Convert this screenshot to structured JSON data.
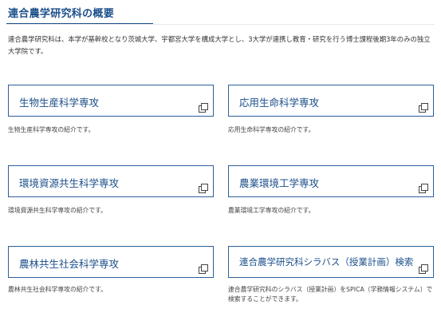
{
  "section": {
    "title": "連合農学研究科の概要",
    "intro": "連合農学研究科は、本学が基幹校となり茨城大学、宇都宮大学を構成大学とし、3大学が連携し教育・研究を行う博士課程後期3年のみの独立大学院です。"
  },
  "cards": [
    {
      "title": "生物生産科学専攻",
      "desc": "生物生産科学専攻の紹介です。",
      "icon": "external-window-icon"
    },
    {
      "title": "応用生命科学専攻",
      "desc": "応用生命科学専攻の紹介です。",
      "icon": "external-window-icon"
    },
    {
      "title": "環境資源共生科学専攻",
      "desc": "環境資源共生科学専攻の紹介です。",
      "icon": "external-window-icon"
    },
    {
      "title": "農業環境工学専攻",
      "desc": "農業環境工学専攻の紹介です。",
      "icon": "external-window-icon"
    },
    {
      "title": "農林共生社会科学専攻",
      "desc": "農林共生社会科学専攻の紹介です。",
      "icon": "external-window-icon"
    },
    {
      "title": "連合農学研究科シラバス（授業計画）検索",
      "desc": "連合農学研究科のシラバス（授業計画）をSPICA（学務情報システム）で検索することができます。",
      "icon": "external-window-icon"
    }
  ],
  "colors": {
    "accent": "#1b4f8a",
    "border": "#2c5f98",
    "text": "#333333"
  }
}
